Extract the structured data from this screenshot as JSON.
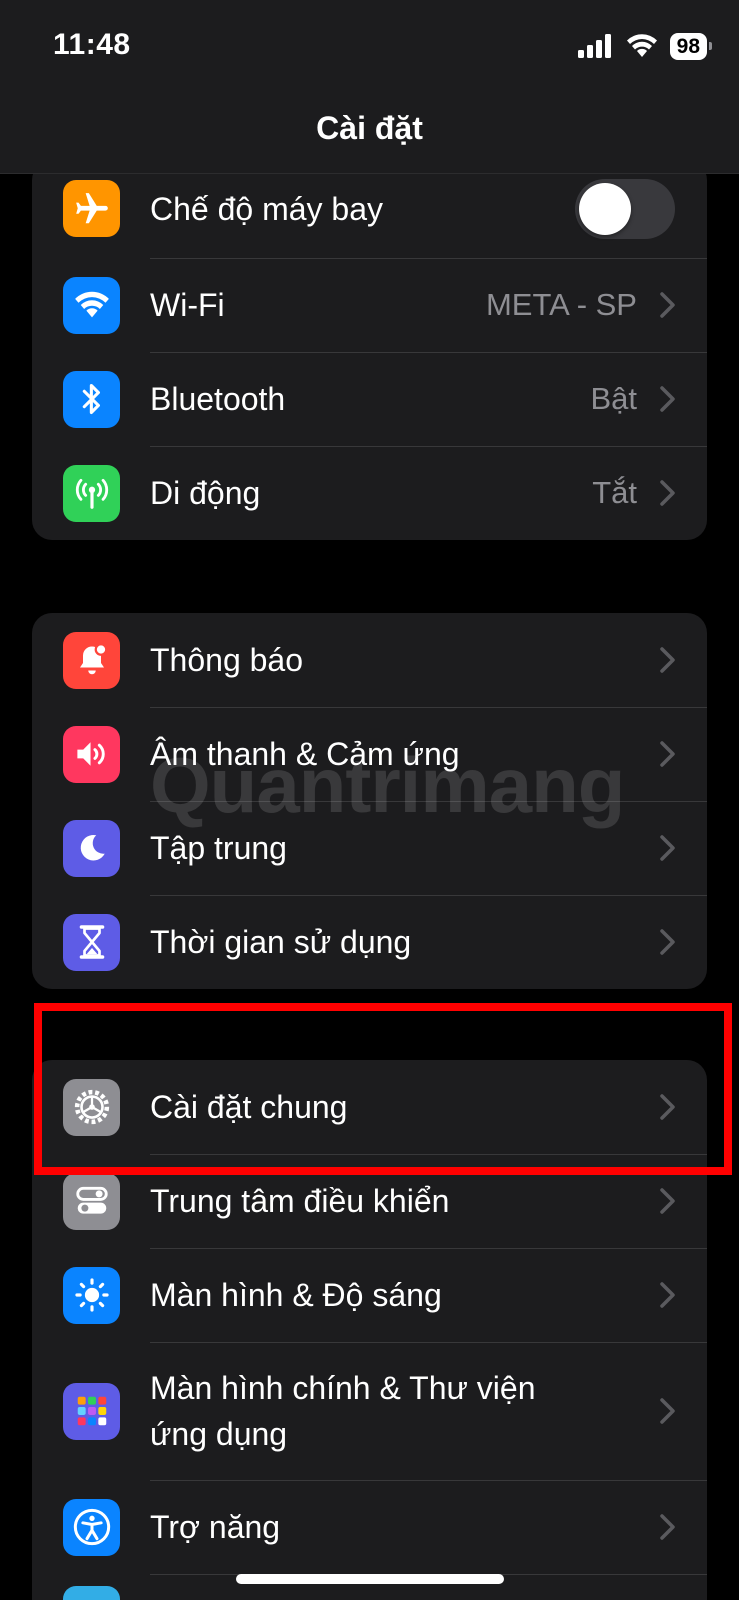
{
  "status_bar": {
    "time": "11:48",
    "battery": "98"
  },
  "header": {
    "title": "Cài đặt"
  },
  "groups": [
    {
      "rows": [
        {
          "label": "Chế độ máy bay",
          "icon": "airplane-icon",
          "color": "#ff9500",
          "toggle": false
        },
        {
          "label": "Wi-Fi",
          "value": "META - SP",
          "icon": "wifi-icon",
          "color": "#0a84ff"
        },
        {
          "label": "Bluetooth",
          "value": "Bật",
          "icon": "bluetooth-icon",
          "color": "#0a84ff"
        },
        {
          "label": "Di động",
          "value": "Tắt",
          "icon": "antenna-icon",
          "color": "#30d158"
        }
      ]
    },
    {
      "rows": [
        {
          "label": "Thông báo",
          "icon": "bell-icon",
          "color": "#ff453a"
        },
        {
          "label": "Âm thanh & Cảm ứng",
          "icon": "speaker-icon",
          "color": "#ff375f"
        },
        {
          "label": "Tập trung",
          "icon": "moon-icon",
          "color": "#5e5ce6"
        },
        {
          "label": "Thời gian sử dụng",
          "icon": "hourglass-icon",
          "color": "#5e5ce6"
        }
      ]
    },
    {
      "rows": [
        {
          "label": "Cài đặt chung",
          "icon": "gear-icon",
          "color": "#8e8e93"
        },
        {
          "label": "Trung tâm điều khiển",
          "icon": "switches-icon",
          "color": "#8e8e93"
        },
        {
          "label": "Màn hình & Độ sáng",
          "icon": "sun-icon",
          "color": "#0a84ff"
        },
        {
          "label": "Màn hình chính & Thư viện ứng dụng",
          "icon": "app-grid-icon",
          "color": "#5e5ce6"
        },
        {
          "label": "Trợ năng",
          "icon": "accessibility-icon",
          "color": "#0a84ff"
        }
      ]
    }
  ],
  "watermark": "Quantrimang"
}
